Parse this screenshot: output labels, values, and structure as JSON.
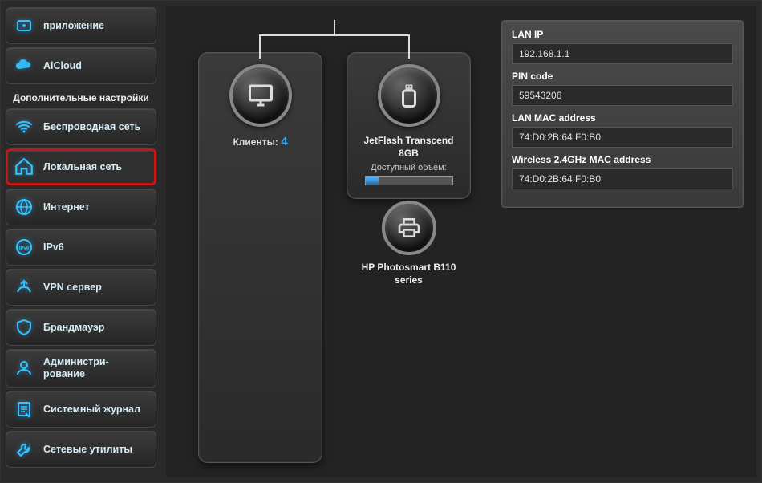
{
  "sidebar": {
    "top_items": [
      {
        "label": "приложение"
      },
      {
        "label": "AiCloud"
      }
    ],
    "section_title": "Дополнительные настройки",
    "items": [
      {
        "label": "Беспроводная сеть"
      },
      {
        "label": "Локальная сеть"
      },
      {
        "label": "Интернет"
      },
      {
        "label": "IPv6"
      },
      {
        "label": "VPN сервер"
      },
      {
        "label": "Брандмауэр"
      },
      {
        "label": "Администри-рование"
      },
      {
        "label": "Системный журнал"
      },
      {
        "label": "Сетевые утилиты"
      }
    ]
  },
  "center": {
    "clients_label": "Клиенты:",
    "clients_count": "4",
    "usb_name": "JetFlash Transcend 8GB",
    "usb_available_label": "Доступный объем:",
    "printer_name": "HP Photosmart B110 series"
  },
  "info": {
    "rows": [
      {
        "label": "LAN IP",
        "value": "192.168.1.1"
      },
      {
        "label": "PIN code",
        "value": "59543206"
      },
      {
        "label": "LAN MAC address",
        "value": "74:D0:2B:64:F0:B0"
      },
      {
        "label": "Wireless 2.4GHz MAC address",
        "value": "74:D0:2B:64:F0:B0"
      }
    ]
  }
}
